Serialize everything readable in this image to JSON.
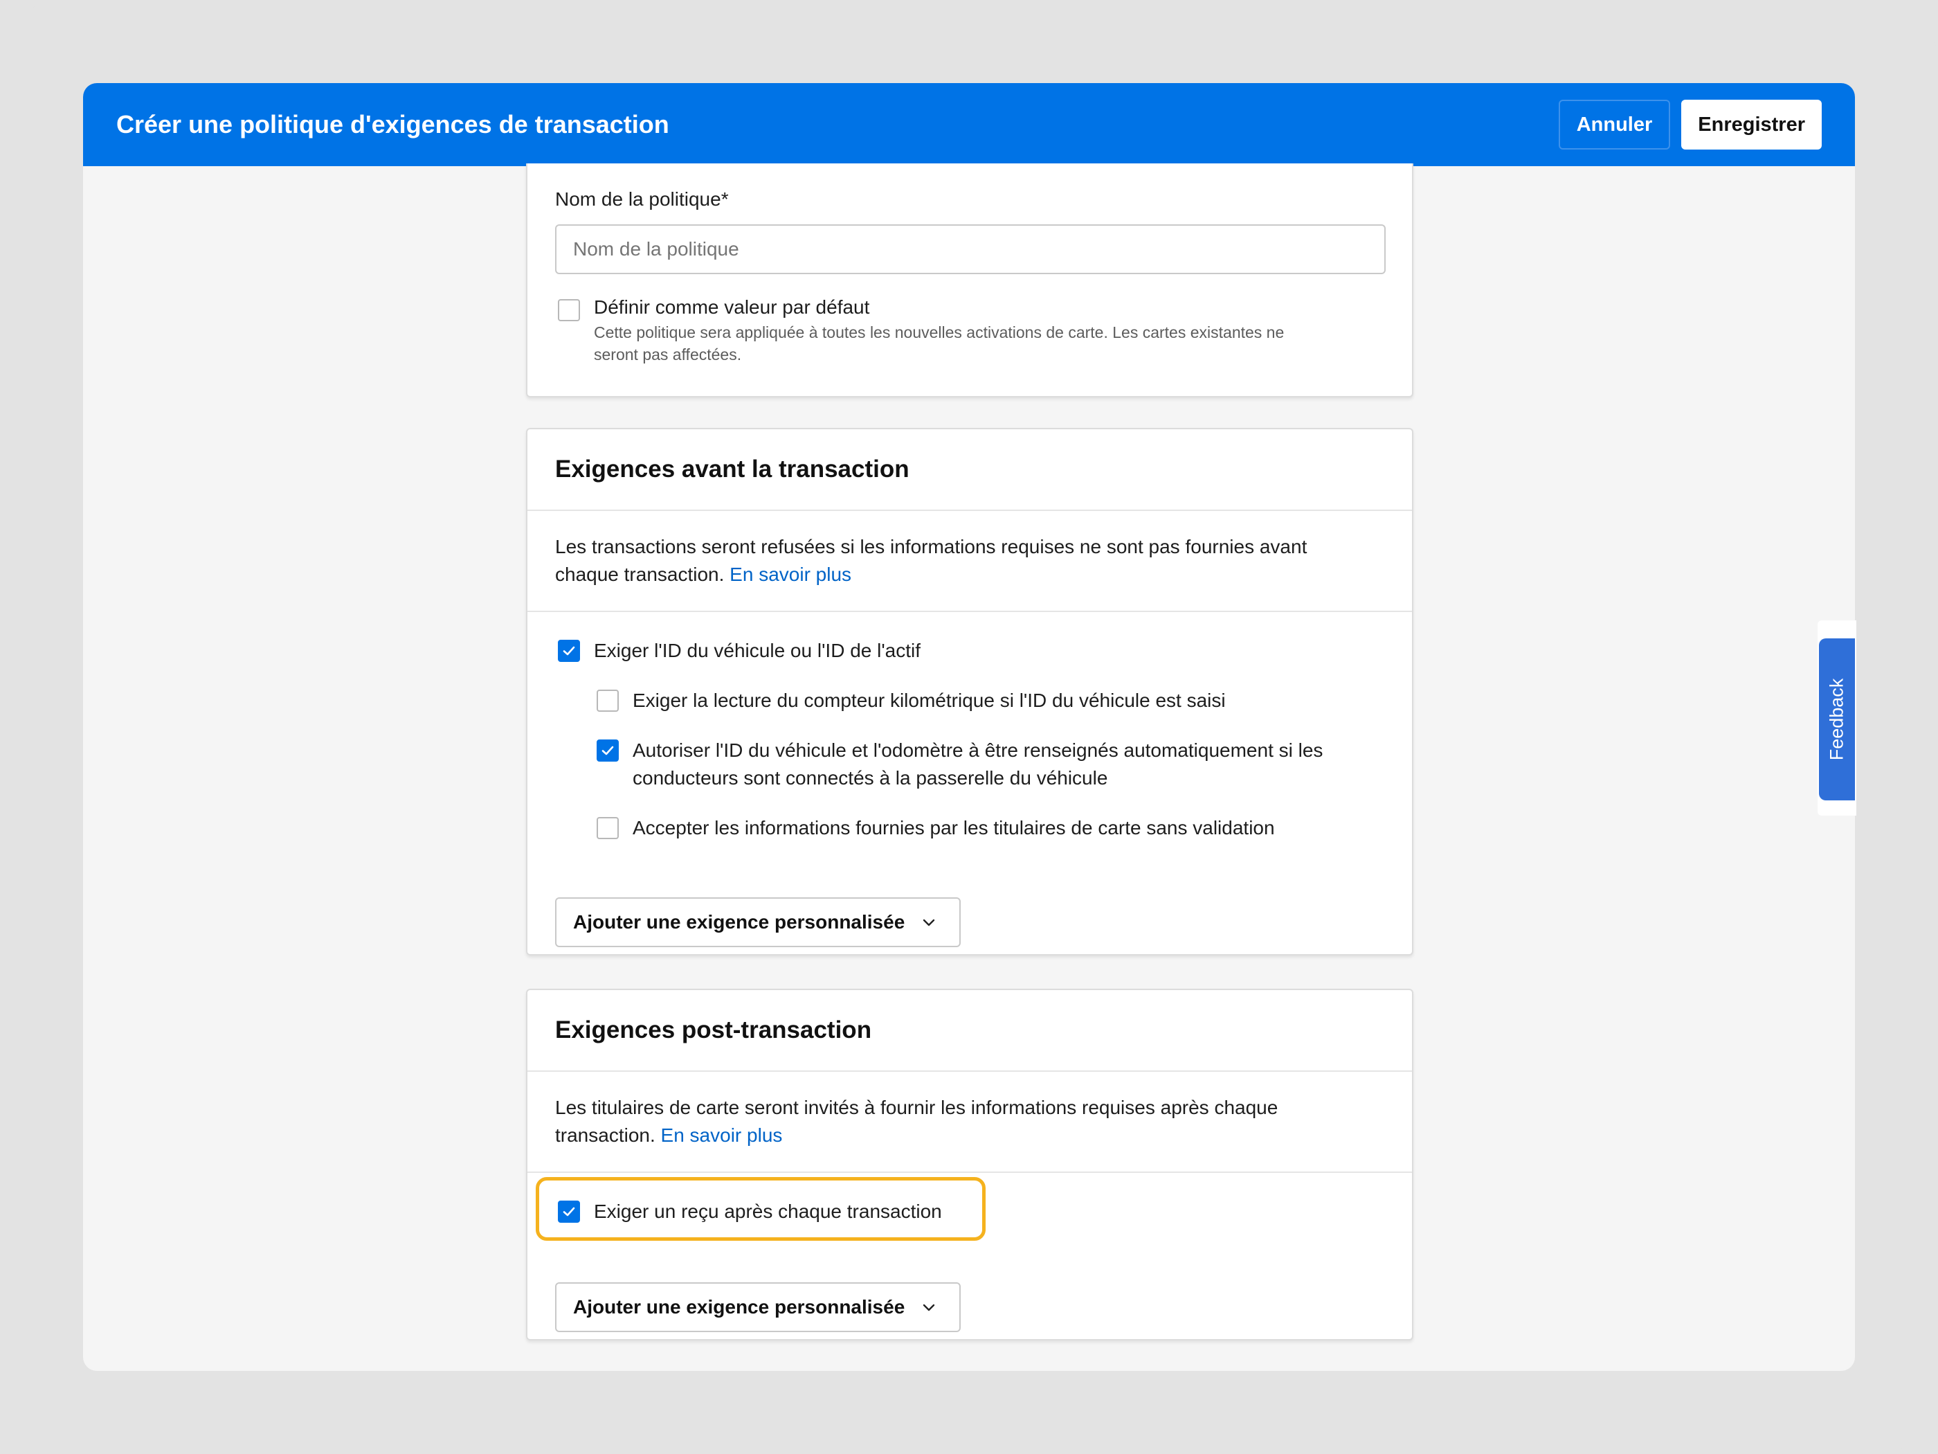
{
  "header": {
    "title": "Créer une politique d'exigences de transaction",
    "cancel_label": "Annuler",
    "save_label": "Enregistrer"
  },
  "policy": {
    "name_label": "Nom de la politique*",
    "name_placeholder": "Nom de la politique",
    "name_value": "",
    "default_label": "Définir comme valeur par défaut",
    "default_checked": false,
    "default_help_line1": "Cette politique sera appliquée à toutes les nouvelles activations de carte. Les cartes existantes ne",
    "default_help_line2": "seront pas affectées."
  },
  "pre_transaction": {
    "title": "Exigences avant la transaction",
    "description_line1": "Les transactions seront refusées si les informations requises ne sont pas fournies avant",
    "description_line2": "chaque transaction.",
    "learn_more": "En savoir plus",
    "options": [
      {
        "label": "Exiger l'ID du véhicule ou l'ID de l'actif",
        "checked": true
      },
      {
        "label": "Exiger la lecture du compteur kilométrique si l'ID du véhicule est saisi",
        "checked": false
      },
      {
        "label_line1": "Autoriser l'ID du véhicule et l'odomètre à être renseignés automatiquement si les",
        "label_line2": "conducteurs sont connectés à la passerelle du véhicule",
        "checked": true
      },
      {
        "label": "Accepter les informations fournies par les titulaires de carte sans validation",
        "checked": false
      }
    ],
    "add_custom_label": "Ajouter une exigence personnalisée"
  },
  "post_transaction": {
    "title": "Exigences post-transaction",
    "description_line1": "Les titulaires de carte seront invités à fournir les informations requises après chaque",
    "description_line2": "transaction.",
    "learn_more": "En savoir plus",
    "options": [
      {
        "label": "Exiger un reçu après chaque transaction",
        "checked": true
      }
    ],
    "add_custom_label": "Ajouter une exigence personnalisée"
  },
  "feedback": {
    "label": "Feedback"
  },
  "colors": {
    "header_bg": "#0073e6",
    "checkbox_checked": "#0073e6",
    "link": "#0063c7",
    "highlight": "#f5b21e"
  }
}
